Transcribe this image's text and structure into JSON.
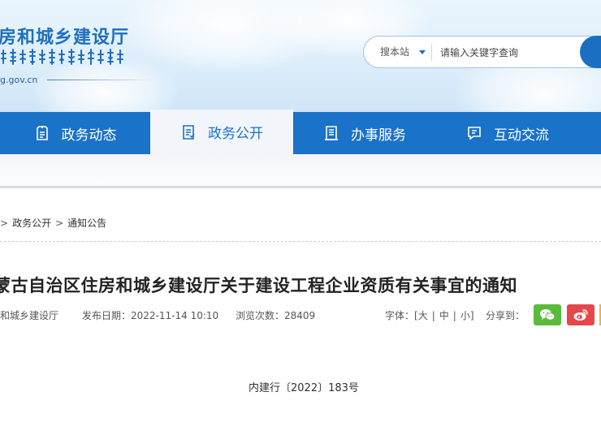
{
  "header": {
    "site_name": "房和城乡建设厅",
    "domain": "g.gov.cn",
    "search": {
      "scope_label": "搜本站",
      "placeholder": "请输入关键字查询"
    }
  },
  "nav": {
    "items": [
      {
        "label": "政务动态",
        "icon": "document-icon"
      },
      {
        "label": "政务公开",
        "icon": "list-doc-icon",
        "active": true
      },
      {
        "label": "办事服务",
        "icon": "service-icon"
      },
      {
        "label": "互动交流",
        "icon": "chat-icon"
      }
    ]
  },
  "breadcrumb": {
    "items": [
      "政务公开",
      "通知公告"
    ],
    "separator": ">"
  },
  "article": {
    "title": "蒙古自治区住房和城乡建设厅关于建设工程企业资质有关事宜的通知",
    "source": "和城乡建设厅",
    "publish_label": "发布日期：",
    "publish_date": "2022-11-14 10:10",
    "views_label": "浏览次数：",
    "views": "28409",
    "font_label": "字体：[",
    "font_large": "大",
    "font_medium": "中",
    "font_small": "小",
    "font_sep": "|",
    "font_close": "]",
    "share_label": "分享到：",
    "doc_number": "内建行〔2022〕183号"
  },
  "colors": {
    "brand_blue": "#1a72c9",
    "wechat_green": "#5cba3b",
    "weibo_red": "#e5474b"
  }
}
